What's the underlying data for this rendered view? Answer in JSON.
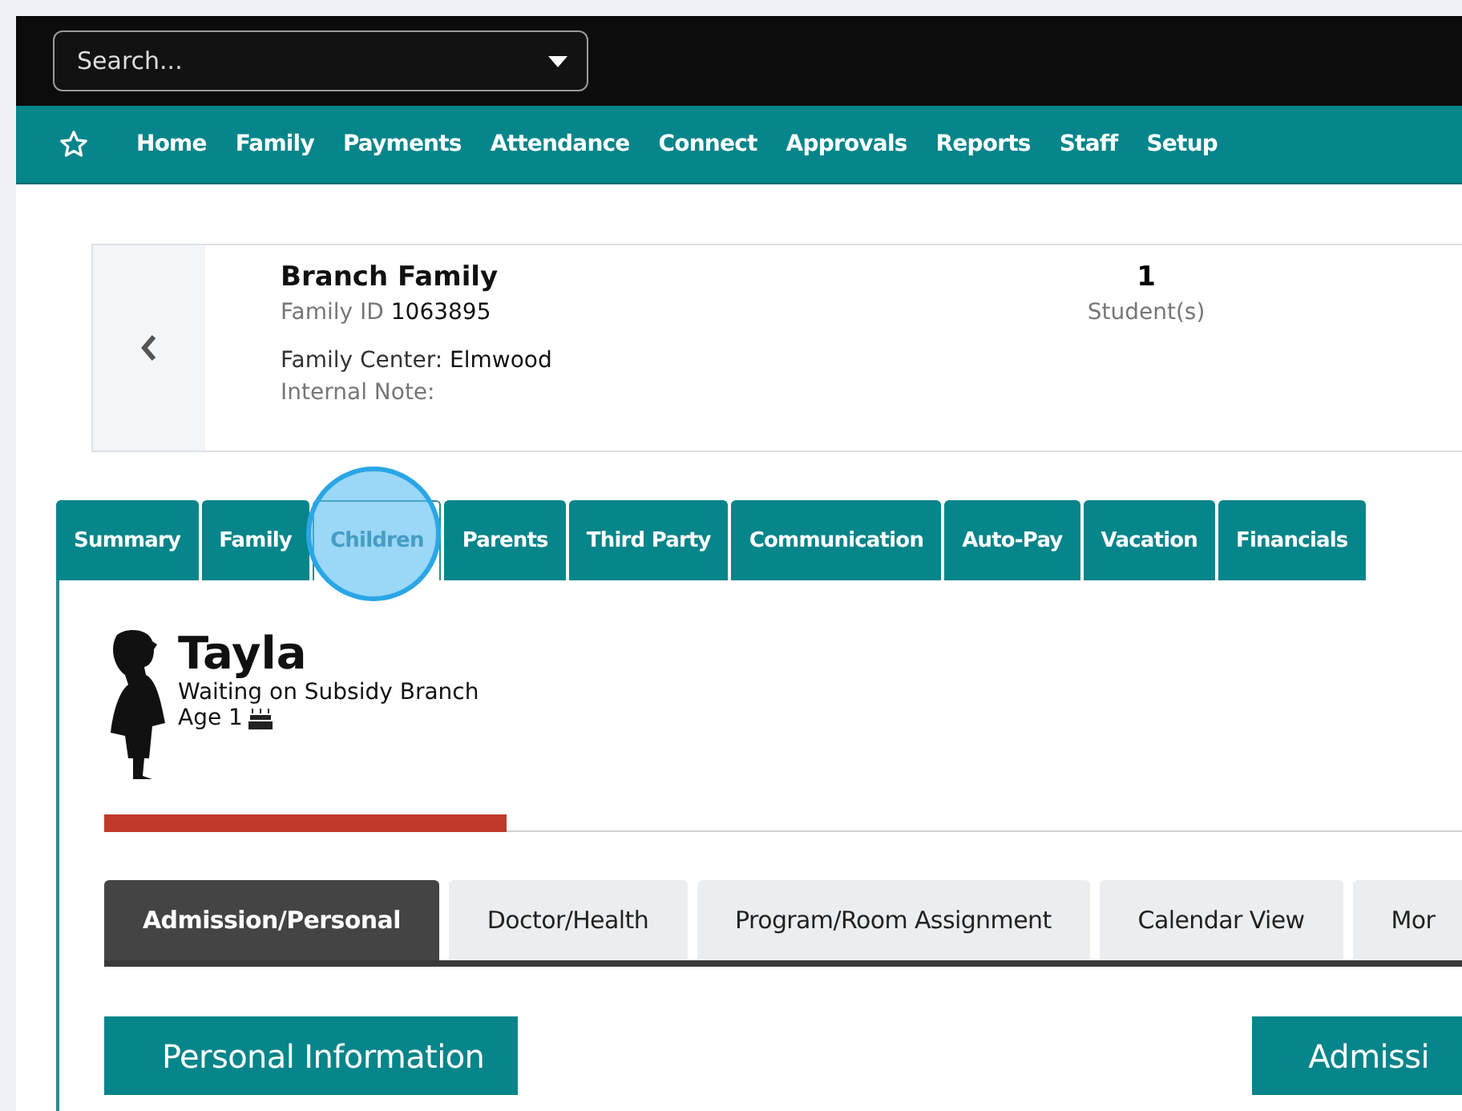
{
  "search": {
    "placeholder": "Search..."
  },
  "nav": {
    "items": [
      "Home",
      "Family",
      "Payments",
      "Attendance",
      "Connect",
      "Approvals",
      "Reports",
      "Staff",
      "Setup"
    ]
  },
  "family_card": {
    "name": "Branch Family",
    "id_label": "Family ID",
    "id_value": "1063895",
    "center_label": "Family Center:",
    "center_value": "Elmwood",
    "note_label": "Internal Note:",
    "students_count": "1",
    "students_label": "Student(s)"
  },
  "tabs": [
    {
      "label": "Summary",
      "selected": false
    },
    {
      "label": "Family",
      "selected": false
    },
    {
      "label": "Children",
      "selected": true
    },
    {
      "label": "Parents",
      "selected": false
    },
    {
      "label": "Third Party",
      "selected": false
    },
    {
      "label": "Communication",
      "selected": false
    },
    {
      "label": "Auto-Pay",
      "selected": false
    },
    {
      "label": "Vacation",
      "selected": false
    },
    {
      "label": "Financials",
      "selected": false
    }
  ],
  "child": {
    "name": "Tayla",
    "status": "Waiting on Subsidy Branch",
    "age": "Age 1"
  },
  "sub_tabs": [
    {
      "label": "Admission/Personal",
      "selected": true
    },
    {
      "label": "Doctor/Health",
      "selected": false
    },
    {
      "label": "Program/Room Assignment",
      "selected": false
    },
    {
      "label": "Calendar View",
      "selected": false
    },
    {
      "label": "Mor",
      "selected": false
    }
  ],
  "sections": [
    "Personal Information",
    "Admissi"
  ]
}
